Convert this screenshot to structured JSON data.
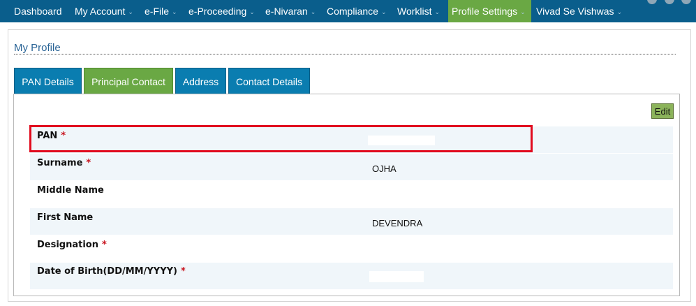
{
  "nav": {
    "items": [
      {
        "label": "Dashboard",
        "caret": ""
      },
      {
        "label": "My Account",
        "caret": "⌄"
      },
      {
        "label": "e-File",
        "caret": "⌄"
      },
      {
        "label": "e-Proceeding",
        "caret": "⌄"
      },
      {
        "label": "e-Nivaran",
        "caret": "⌄"
      },
      {
        "label": "Compliance",
        "caret": "⌄"
      },
      {
        "label": "Worklist",
        "caret": "⌄"
      },
      {
        "label": "Profile Settings",
        "caret": "⌄"
      },
      {
        "label": "Vivad Se Vishwas",
        "caret": "⌄"
      }
    ],
    "active": "Profile Settings"
  },
  "page": {
    "title": "My Profile"
  },
  "tabs": [
    {
      "label": "PAN Details"
    },
    {
      "label": "Principal Contact"
    },
    {
      "label": "Address"
    },
    {
      "label": "Contact Details"
    }
  ],
  "active_tab": "Principal Contact",
  "edit_label": "Edit",
  "required_mark": "*",
  "fields": [
    {
      "label": "PAN",
      "value": ""
    },
    {
      "label": "Surname",
      "value": "OJHA"
    },
    {
      "label": "Middle Name",
      "value": ""
    },
    {
      "label": "First Name",
      "value": "DEVENDRA"
    },
    {
      "label": "Designation",
      "value": ""
    },
    {
      "label": "Date of Birth(DD/MM/YYYY)",
      "value": ""
    }
  ],
  "colors": {
    "nav_bg": "#0a5e8c",
    "active": "#6aa844",
    "tab": "#0a7db0",
    "highlight": "#e10b1e",
    "required": "#c8141e"
  }
}
